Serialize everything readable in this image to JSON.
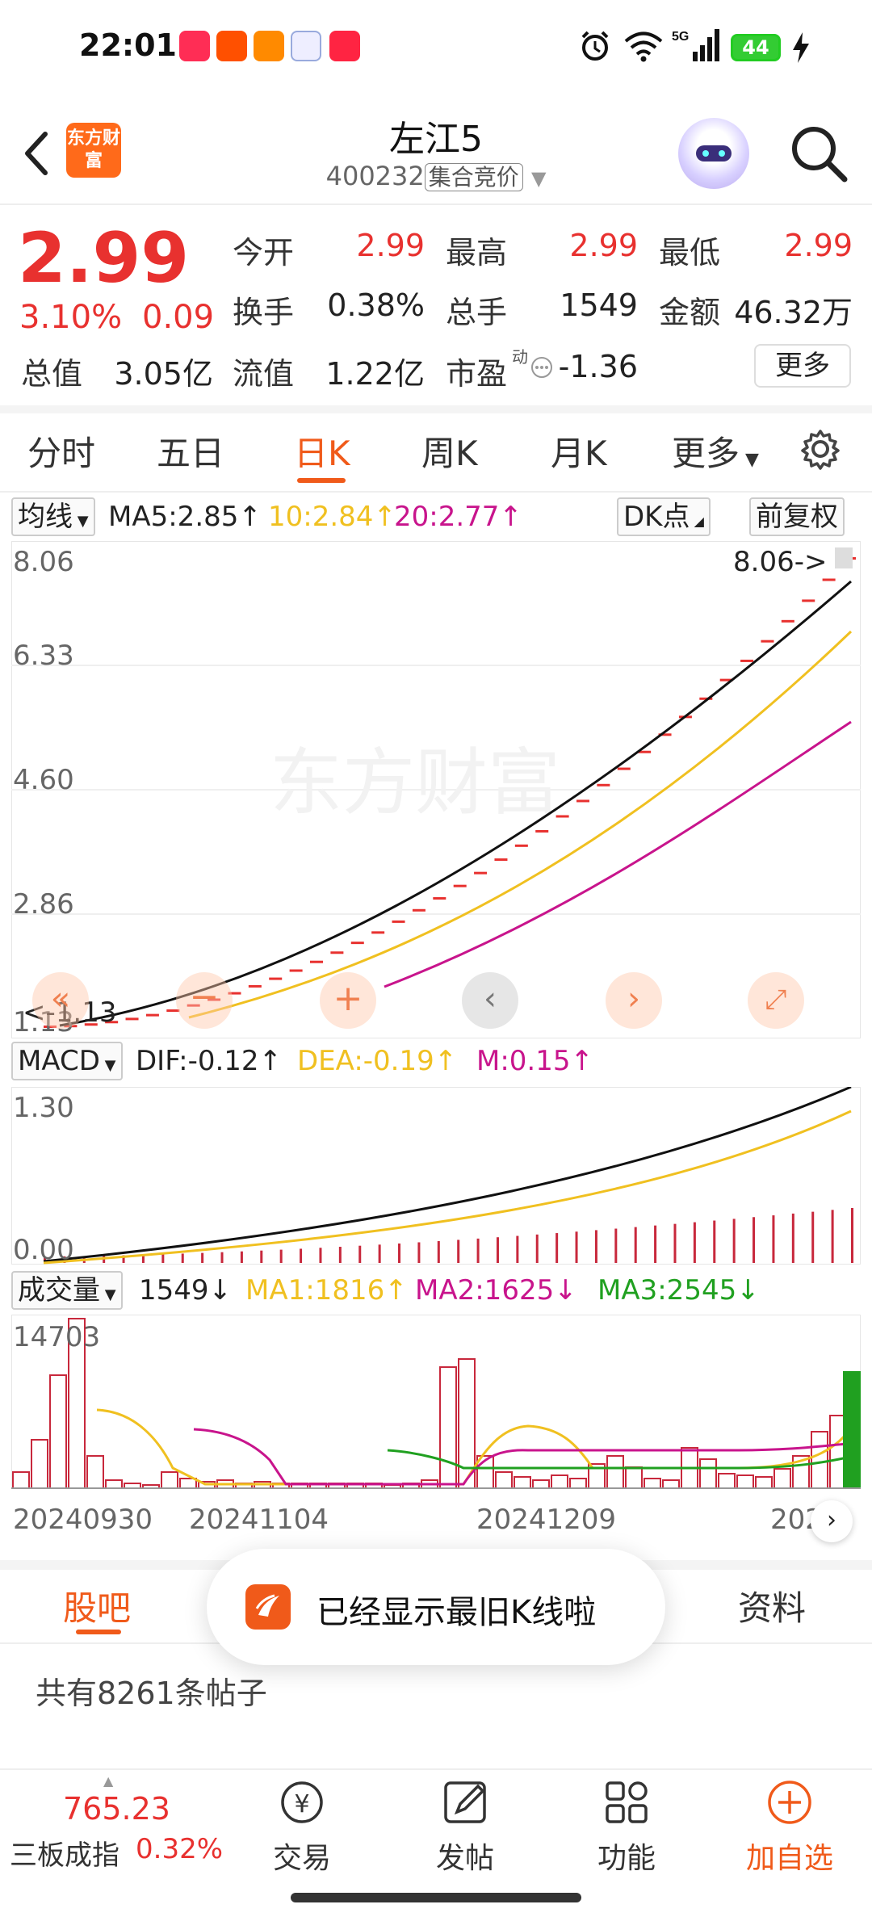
{
  "status_bar": {
    "time": "22:01",
    "battery": "44"
  },
  "header": {
    "logo_text": "东方财富",
    "title": "左江5",
    "code": "400232",
    "tag": "集合竞价"
  },
  "quote": {
    "price": "2.99",
    "pct": "3.10%",
    "chg": "0.09",
    "fields": [
      {
        "label": "今开",
        "value": "2.99"
      },
      {
        "label": "最高",
        "value": "2.99"
      },
      {
        "label": "最低",
        "value": "2.99"
      },
      {
        "label": "换手",
        "value": "0.38%"
      },
      {
        "label": "总手",
        "value": "1549"
      },
      {
        "label": "金额",
        "value": "46.32万"
      },
      {
        "label": "总值",
        "value": "3.05亿"
      },
      {
        "label": "流值",
        "value": "1.22亿"
      },
      {
        "label": "市盈",
        "value": "-1.36"
      }
    ],
    "pe_dynamic": "动",
    "more_label": "更多"
  },
  "tabs": [
    "分时",
    "五日",
    "日K",
    "周K",
    "月K",
    "更多"
  ],
  "active_tab": "日K",
  "kline_panel": {
    "indicator": "均线",
    "ma5": "MA5:2.85",
    "ma10": "10:2.84",
    "ma20": "20:2.77",
    "dk_label": "DK点",
    "fq_label": "前复权",
    "y_labels": [
      "8.06",
      "6.33",
      "4.60",
      "2.86",
      "1.13"
    ],
    "max_marker": "8.06->",
    "min_marker": "<-1.13",
    "watermark": "东方财富"
  },
  "macd_panel": {
    "indicator": "MACD",
    "dif": "DIF:-0.12",
    "dea": "DEA:-0.19",
    "m": "M:0.15",
    "y_labels": [
      "1.30",
      "0.00"
    ]
  },
  "volume_panel": {
    "indicator": "成交量",
    "vol": "1549",
    "ma1": "MA1:1816",
    "ma2": "MA2:1625",
    "ma3": "MA3:2545",
    "y_max": "14703",
    "dates": [
      "20240930",
      "20241104",
      "20241209",
      "202"
    ]
  },
  "community": {
    "tabs": [
      "股吧",
      "资料"
    ],
    "toast": "已经显示最旧K线啦",
    "post_count": "共有8261条帖子"
  },
  "bottom_nav": {
    "index_value": "765.23",
    "index_name": "三板成指",
    "index_pct": "0.32%",
    "items": [
      "交易",
      "发帖",
      "功能",
      "加自选"
    ]
  },
  "colors": {
    "up": "#e8312f",
    "accent": "#f05a1a",
    "ma10": "#f0c020",
    "ma20": "#c8148c",
    "ma3": "#20a020"
  }
}
